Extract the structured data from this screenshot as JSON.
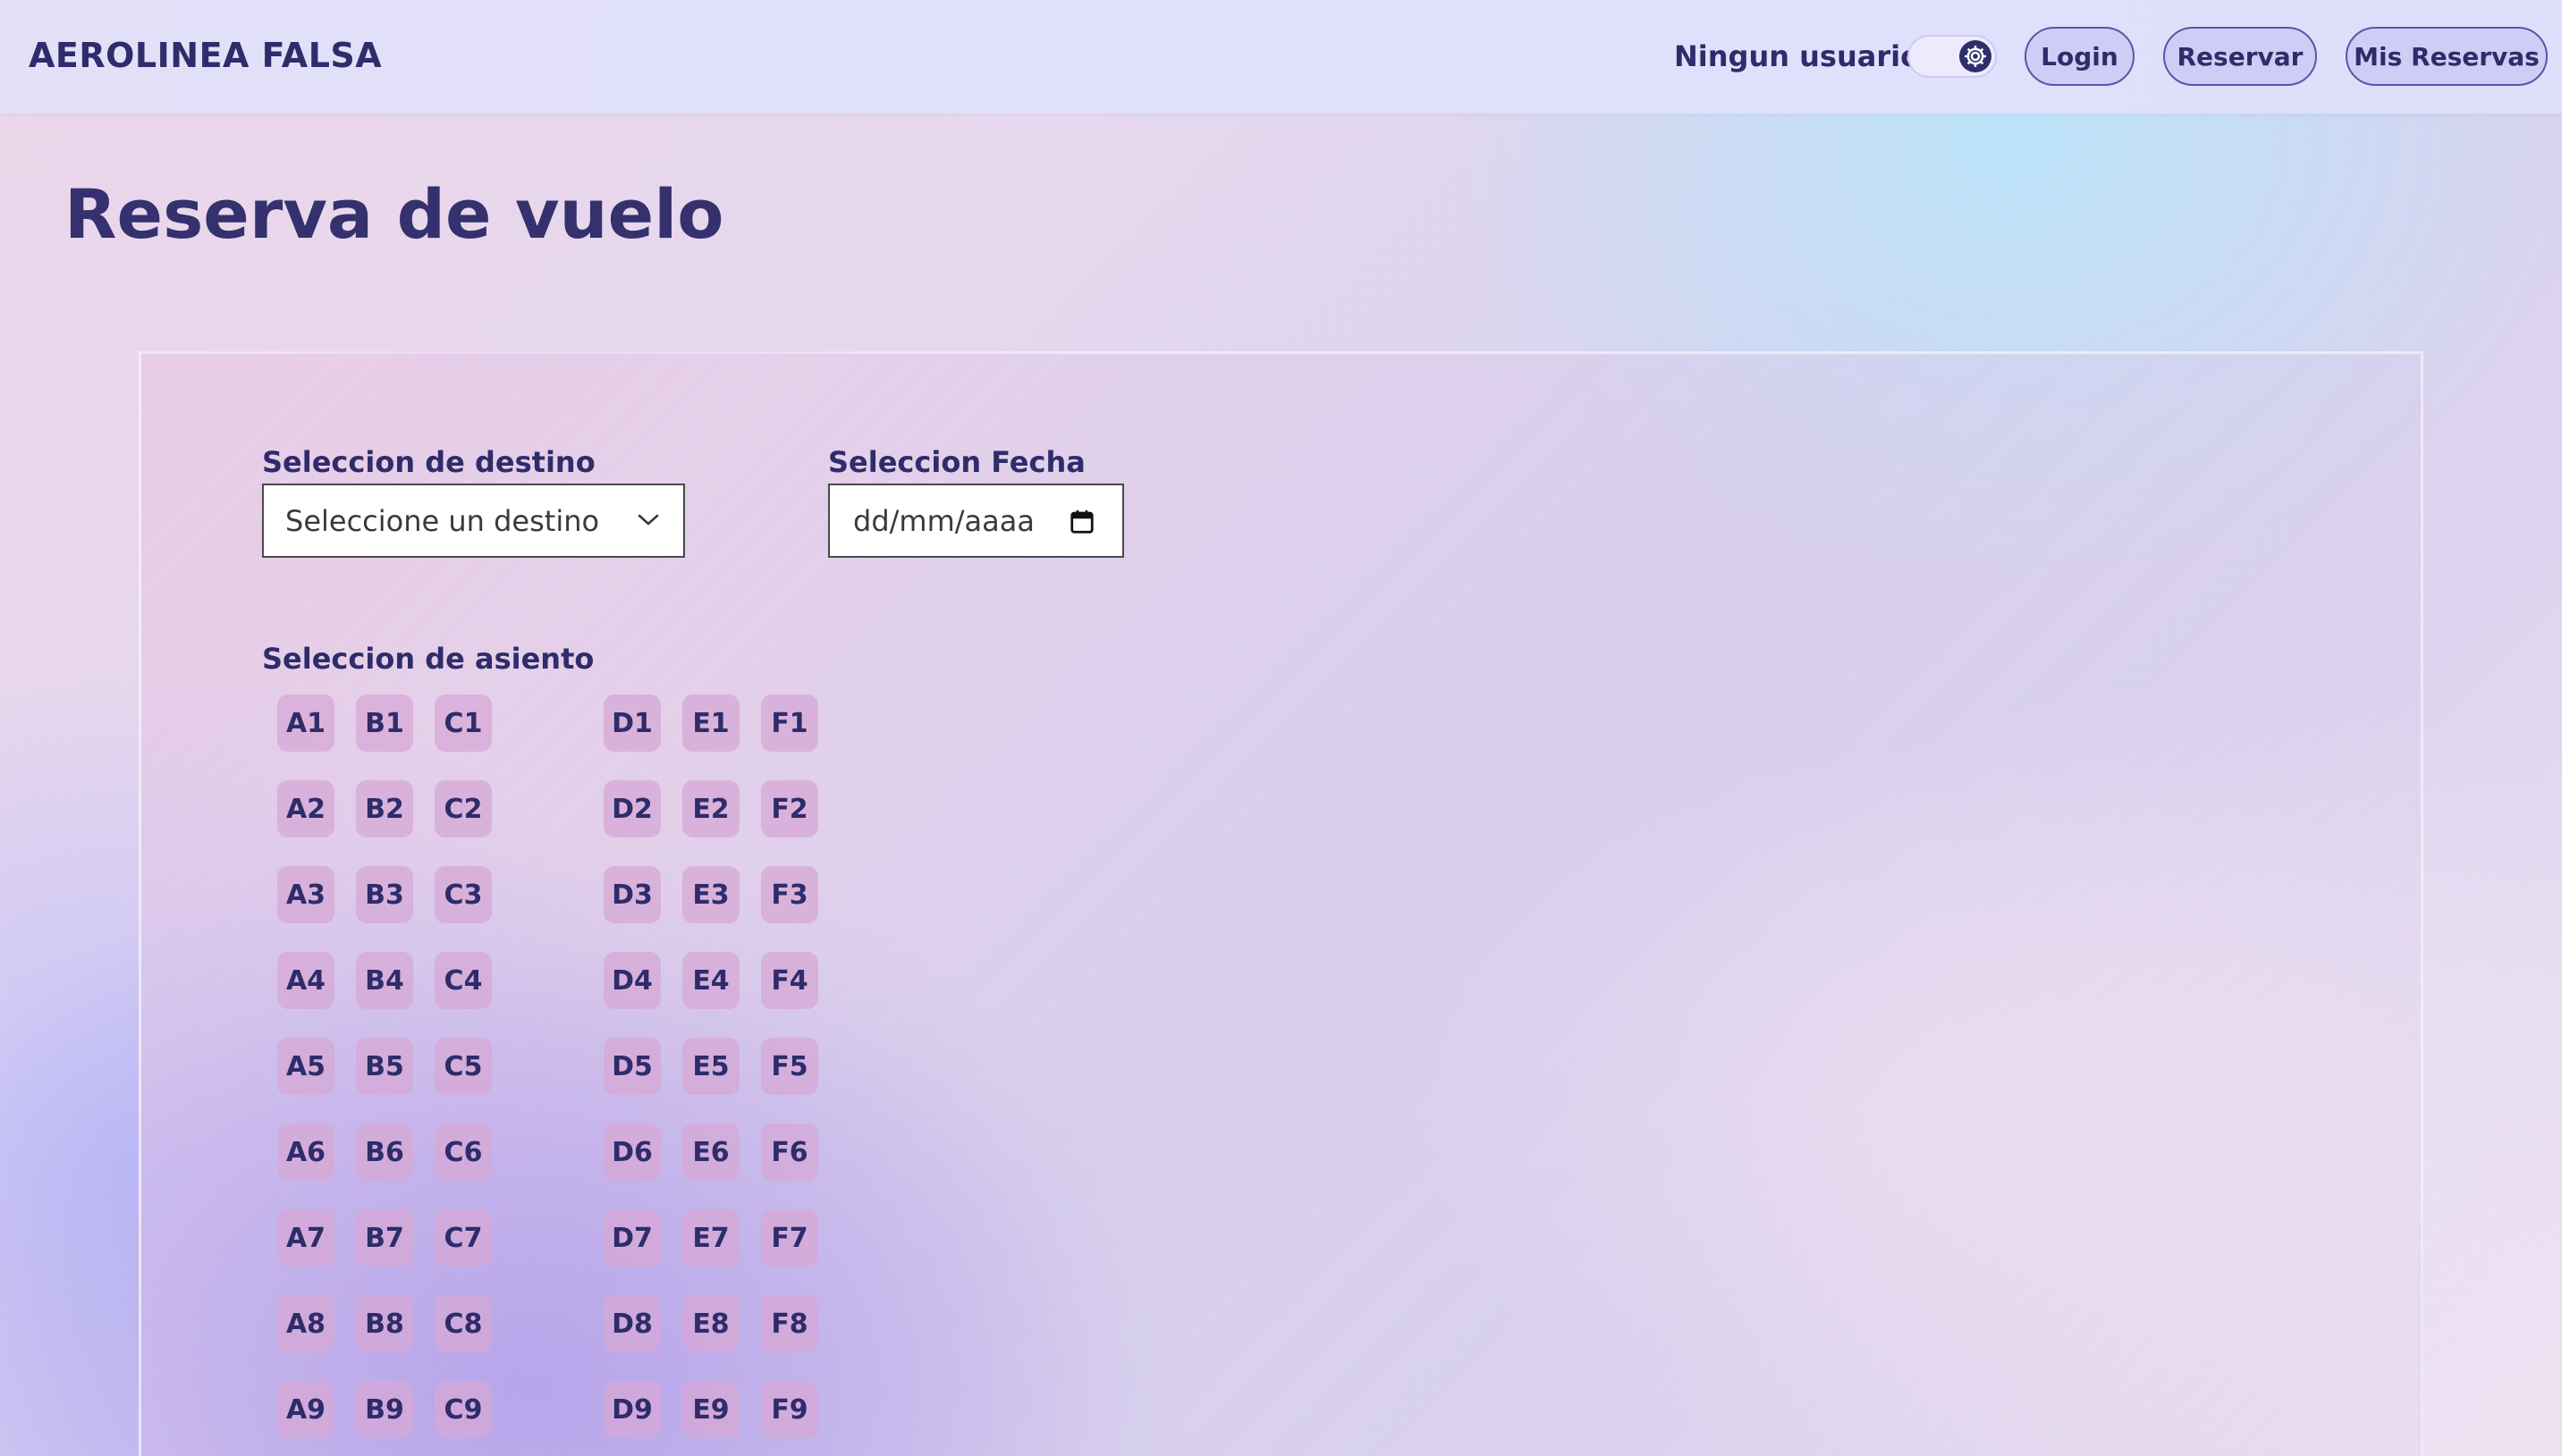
{
  "header": {
    "brand": "AEROLINEA FALSA",
    "user_status": "Ningun usuario",
    "theme_toggle_icon": "gear-icon",
    "nav": {
      "login": "Login",
      "reservar": "Reservar",
      "mis_reservas": "Mis Reservas"
    }
  },
  "page": {
    "title": "Reserva de vuelo"
  },
  "form": {
    "destination": {
      "label": "Seleccion de destino",
      "selected": "Seleccione un destino"
    },
    "date": {
      "label": "Seleccion Fecha",
      "placeholder": "dd/mm/aaaa"
    },
    "seats": {
      "label": "Seleccion de asiento",
      "columns_left": [
        "A",
        "B",
        "C"
      ],
      "columns_right": [
        "D",
        "E",
        "F"
      ],
      "rows": [
        1,
        2,
        3,
        4,
        5,
        6,
        7,
        8,
        9
      ]
    }
  },
  "colors": {
    "text": "#2e2c6a",
    "button_bg": "#cfcdf5",
    "seat_bg": "#d6a8d6"
  }
}
